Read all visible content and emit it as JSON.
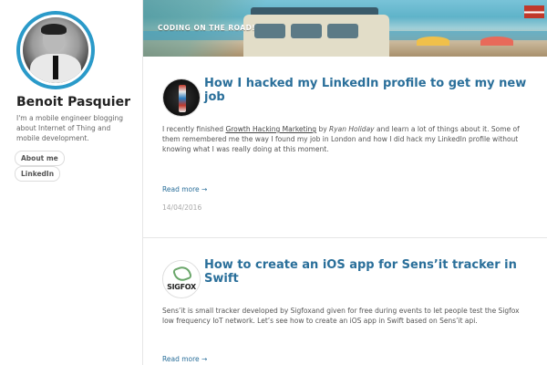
{
  "sidebar": {
    "author_name": "Benoit Pasquier",
    "bio": "I'm a mobile engineer blogging about Internet of Thing and mobile development.",
    "links": [
      {
        "label": "About me"
      },
      {
        "label": "LinkedIn"
      }
    ]
  },
  "header": {
    "title": "CODING ON THE ROAD!"
  },
  "posts": [
    {
      "title": "How I hacked my LinkedIn profile to get my new job",
      "body_pre": "I recently finished ",
      "body_link": "Growth Hacking Marketing",
      "body_mid": " by ",
      "body_author": "Ryan Holiday",
      "body_post": " and learn a lot of things about it. Some of them remembered me the way I found my job in London and how I did hack my LinkedIn profile without knowing what I was really doing at this moment.",
      "read_more": "Read more →",
      "date": "14/04/2016",
      "thumb_icon": "tie-icon"
    },
    {
      "title": "How to create an iOS app for Sens’it tracker in Swift",
      "body": "Sens’it is small tracker developed by Sigfoxand given for free during events to let people test the Sigfox low frequency IoT network. Let’s see how to create an iOS app in Swift based on Sens’it api.",
      "read_more": "Read more →",
      "thumb_brand": "SIGFOX",
      "thumb_icon": "sigfox-logo-icon"
    }
  ],
  "colors": {
    "accent": "#2a9ac9",
    "title_link": "#2a6f9a"
  }
}
